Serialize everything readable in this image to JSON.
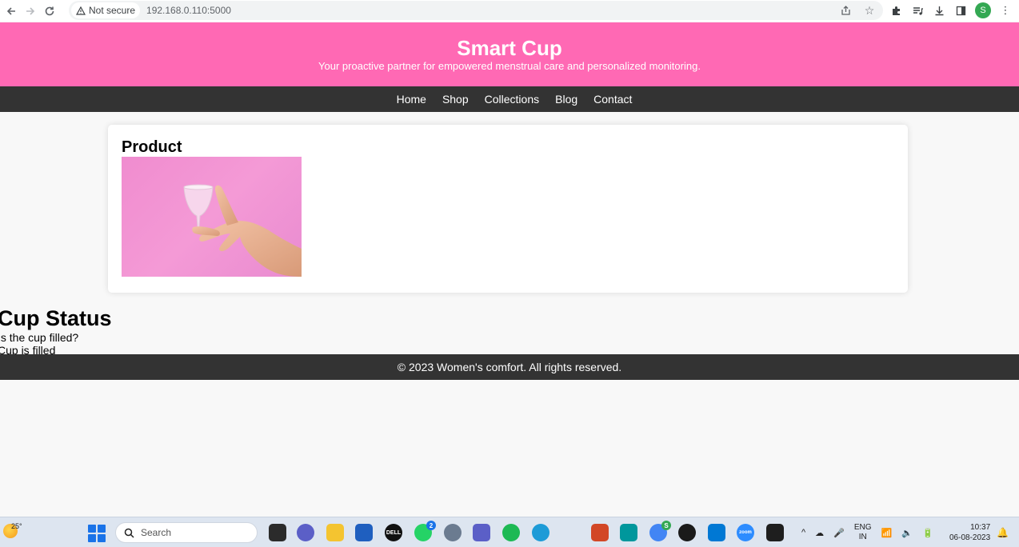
{
  "browser": {
    "security_label": "Not secure",
    "url": "192.168.0.110:5000",
    "profile_initial": "S"
  },
  "header": {
    "title": "Smart Cup",
    "tagline": "Your proactive partner for empowered menstrual care and personalized monitoring."
  },
  "nav": {
    "items": [
      "Home",
      "Shop",
      "Collections",
      "Blog",
      "Contact"
    ]
  },
  "product": {
    "heading": "Product",
    "image_icon": "menstrual-cup-in-hand"
  },
  "status": {
    "heading": "Cup Status",
    "question": "Is the cup filled?",
    "answer": "Cup is filled"
  },
  "footer": {
    "text": "© 2023 Women's comfort. All rights reserved."
  },
  "taskbar": {
    "temperature": "25°",
    "search_placeholder": "Search",
    "whatsapp_badge": "2",
    "chrome_badge": "S",
    "language_line1": "ENG",
    "language_line2": "IN",
    "time": "10:37",
    "date": "06-08-2023"
  },
  "colors": {
    "header_bg": "#ff69b4",
    "nav_bg": "#333333",
    "footer_bg": "#333333",
    "page_bg": "#f8f8f8"
  }
}
